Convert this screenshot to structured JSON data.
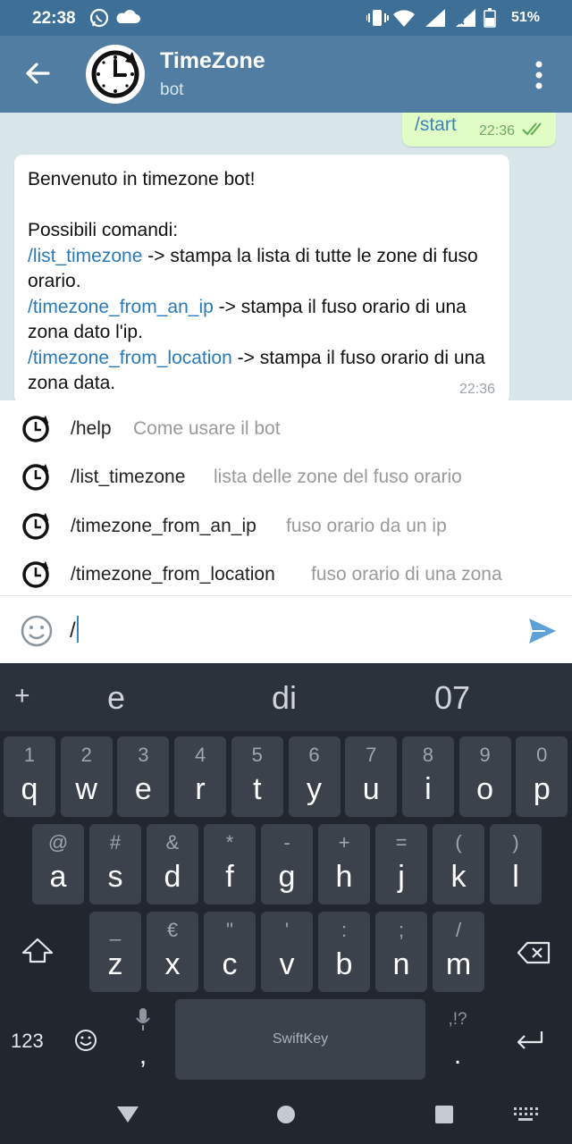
{
  "status_bar": {
    "time": "22:38",
    "battery": "51%",
    "left_icons": [
      "whatsapp-icon",
      "cloud-icon"
    ],
    "right_icons": [
      "vibrate-icon",
      "wifi-icon",
      "signal-icon",
      "signal-x-icon",
      "battery-icon"
    ]
  },
  "header": {
    "title": "TimeZone",
    "subtitle": "bot",
    "color": "#517da2"
  },
  "chat": {
    "outgoing": {
      "text": "/start",
      "time": "22:36",
      "status": "read"
    },
    "incoming": {
      "line1": "Benvenuto in timezone bot!",
      "line2": "Possibili comandi:",
      "cmd1": "/list_timezone",
      "cmd1_desc": " -> stampa la lista di tutte le zone di fuso orario.",
      "cmd2": "/timezone_from_an_ip",
      "cmd2_desc": " -> stampa il fuso orario di una zona dato l'ip.",
      "cmd3": "/timezone_from_location",
      "cmd3_desc": " -> stampa il fuso orario di una zona data.",
      "time": "22:36"
    }
  },
  "suggestions": [
    {
      "command": "/help",
      "description": "Come usare il bot"
    },
    {
      "command": "/list_timezone",
      "description": "lista delle zone del fuso orario"
    },
    {
      "command": "/timezone_from_an_ip",
      "description": "fuso orario da un ip"
    },
    {
      "command": "/timezone_from_location",
      "description": "fuso orario di una zona"
    }
  ],
  "input": {
    "value": "/"
  },
  "keyboard": {
    "predictions": [
      "e",
      "di",
      "07"
    ],
    "row1": [
      {
        "alt": "1",
        "key": "q"
      },
      {
        "alt": "2",
        "key": "w"
      },
      {
        "alt": "3",
        "key": "e"
      },
      {
        "alt": "4",
        "key": "r"
      },
      {
        "alt": "5",
        "key": "t"
      },
      {
        "alt": "6",
        "key": "y"
      },
      {
        "alt": "7",
        "key": "u"
      },
      {
        "alt": "8",
        "key": "i"
      },
      {
        "alt": "9",
        "key": "o"
      },
      {
        "alt": "0",
        "key": "p"
      }
    ],
    "row2": [
      {
        "alt": "@",
        "key": "a"
      },
      {
        "alt": "#",
        "key": "s"
      },
      {
        "alt": "&",
        "key": "d"
      },
      {
        "alt": "*",
        "key": "f"
      },
      {
        "alt": "-",
        "key": "g"
      },
      {
        "alt": "+",
        "key": "h"
      },
      {
        "alt": "=",
        "key": "j"
      },
      {
        "alt": "(",
        "key": "k"
      },
      {
        "alt": ")",
        "key": "l"
      }
    ],
    "row3": [
      {
        "alt": "_",
        "key": "z"
      },
      {
        "alt": "€",
        "key": "x"
      },
      {
        "alt": "\"",
        "key": "c"
      },
      {
        "alt": "'",
        "key": "v"
      },
      {
        "alt": ":",
        "key": "b"
      },
      {
        "alt": ";",
        "key": "n"
      },
      {
        "alt": "/",
        "key": "m"
      }
    ],
    "numbers_key": "123",
    "comma_key": ",",
    "period_key": ".",
    "period_alt": ",!?",
    "space_brand": "SwiftKey"
  }
}
